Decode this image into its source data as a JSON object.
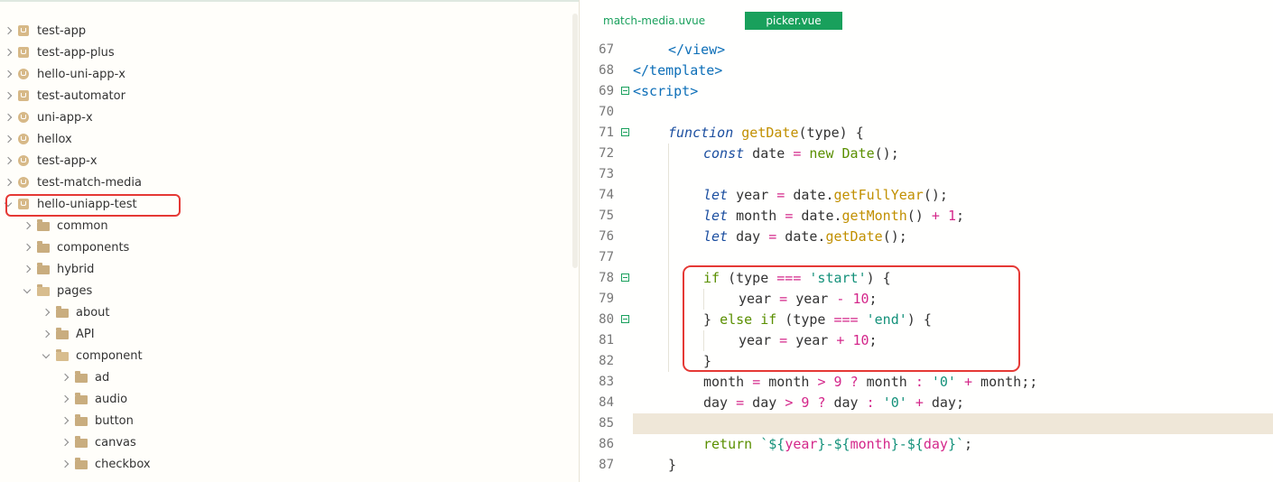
{
  "explorer": {
    "projects": [
      {
        "label": "test-app",
        "icon": "project-square-icon"
      },
      {
        "label": "test-app-plus",
        "icon": "project-square-icon"
      },
      {
        "label": "hello-uni-app-x",
        "icon": "project-round-icon"
      },
      {
        "label": "test-automator",
        "icon": "project-square-icon"
      },
      {
        "label": "uni-app-x",
        "icon": "project-round-icon"
      },
      {
        "label": "hellox",
        "icon": "project-round-icon"
      },
      {
        "label": "test-app-x",
        "icon": "project-round-icon"
      },
      {
        "label": "test-match-media",
        "icon": "project-round-icon"
      },
      {
        "label": "hello-uniapp-test",
        "icon": "project-square-icon",
        "expanded": true,
        "highlighted": true
      }
    ],
    "children": [
      {
        "label": "common",
        "level": 1
      },
      {
        "label": "components",
        "level": 1
      },
      {
        "label": "hybrid",
        "level": 1
      },
      {
        "label": "pages",
        "level": 1,
        "expanded": true
      },
      {
        "label": "about",
        "level": 2
      },
      {
        "label": "API",
        "level": 2
      },
      {
        "label": "component",
        "level": 2,
        "expanded": true
      },
      {
        "label": "ad",
        "level": 3
      },
      {
        "label": "audio",
        "level": 3
      },
      {
        "label": "button",
        "level": 3
      },
      {
        "label": "canvas",
        "level": 3
      },
      {
        "label": "checkbox",
        "level": 3
      }
    ]
  },
  "editor": {
    "tabs": [
      {
        "label": "match-media.uvue",
        "active": false
      },
      {
        "label": "picker.vue",
        "active": true
      }
    ],
    "current_line": 85,
    "highlighted_lines": [
      78,
      82
    ],
    "lines": [
      {
        "n": "67",
        "indent": 1,
        "fold": false,
        "tokens": [
          [
            "tag",
            "</view>"
          ]
        ]
      },
      {
        "n": "68",
        "indent": 0,
        "fold": false,
        "tokens": [
          [
            "tag",
            "</template>"
          ]
        ]
      },
      {
        "n": "69",
        "indent": 0,
        "fold": true,
        "tokens": [
          [
            "tag",
            "<script>"
          ]
        ]
      },
      {
        "n": "70",
        "indent": 0,
        "fold": false,
        "tokens": []
      },
      {
        "n": "71",
        "indent": 1,
        "fold": true,
        "tokens": [
          [
            "kw-italic",
            "function"
          ],
          [
            "",
            " "
          ],
          [
            "fn",
            "getDate"
          ],
          [
            "",
            "(type) {"
          ]
        ]
      },
      {
        "n": "72",
        "indent": 2,
        "fold": false,
        "tokens": [
          [
            "kw-italic",
            "const"
          ],
          [
            "",
            " date "
          ],
          [
            "op",
            "="
          ],
          [
            "",
            " "
          ],
          [
            "kw-green",
            "new"
          ],
          [
            "",
            " "
          ],
          [
            "kw-green",
            "Date"
          ],
          [
            "",
            "();"
          ]
        ]
      },
      {
        "n": "73",
        "indent": 0,
        "fold": false,
        "tokens": []
      },
      {
        "n": "74",
        "indent": 2,
        "fold": false,
        "tokens": [
          [
            "kw-italic",
            "let"
          ],
          [
            "",
            " year "
          ],
          [
            "op",
            "="
          ],
          [
            "",
            " date."
          ],
          [
            "fn",
            "getFullYear"
          ],
          [
            "",
            "();"
          ]
        ]
      },
      {
        "n": "75",
        "indent": 2,
        "fold": false,
        "tokens": [
          [
            "kw-italic",
            "let"
          ],
          [
            "",
            " month "
          ],
          [
            "op",
            "="
          ],
          [
            "",
            " date."
          ],
          [
            "fn",
            "getMonth"
          ],
          [
            "",
            "() "
          ],
          [
            "op",
            "+"
          ],
          [
            "",
            " "
          ],
          [
            "num",
            "1"
          ],
          [
            "",
            ";"
          ]
        ]
      },
      {
        "n": "76",
        "indent": 2,
        "fold": false,
        "tokens": [
          [
            "kw-italic",
            "let"
          ],
          [
            "",
            " day "
          ],
          [
            "op",
            "="
          ],
          [
            "",
            " date."
          ],
          [
            "fn",
            "getDate"
          ],
          [
            "",
            "();"
          ]
        ]
      },
      {
        "n": "77",
        "indent": 0,
        "fold": false,
        "tokens": []
      },
      {
        "n": "78",
        "indent": 2,
        "fold": true,
        "tokens": [
          [
            "kw-green",
            "if"
          ],
          [
            "",
            " (type "
          ],
          [
            "op",
            "==="
          ],
          [
            "",
            " "
          ],
          [
            "str",
            "'start'"
          ],
          [
            "",
            ") {"
          ]
        ]
      },
      {
        "n": "79",
        "indent": 3,
        "fold": false,
        "tokens": [
          [
            "",
            "year "
          ],
          [
            "op",
            "="
          ],
          [
            "",
            " year "
          ],
          [
            "op",
            "-"
          ],
          [
            "",
            " "
          ],
          [
            "num",
            "10"
          ],
          [
            "",
            ";"
          ]
        ]
      },
      {
        "n": "80",
        "indent": 2,
        "fold": true,
        "tokens": [
          [
            "",
            "} "
          ],
          [
            "kw-green",
            "else"
          ],
          [
            "",
            " "
          ],
          [
            "kw-green",
            "if"
          ],
          [
            "",
            " (type "
          ],
          [
            "op",
            "==="
          ],
          [
            "",
            " "
          ],
          [
            "str",
            "'end'"
          ],
          [
            "",
            ") {"
          ]
        ]
      },
      {
        "n": "81",
        "indent": 3,
        "fold": false,
        "tokens": [
          [
            "",
            "year "
          ],
          [
            "op",
            "="
          ],
          [
            "",
            " year "
          ],
          [
            "op",
            "+"
          ],
          [
            "",
            " "
          ],
          [
            "num",
            "10"
          ],
          [
            "",
            ";"
          ]
        ]
      },
      {
        "n": "82",
        "indent": 2,
        "fold": false,
        "tokens": [
          [
            "",
            "}"
          ]
        ]
      },
      {
        "n": "83",
        "indent": 2,
        "fold": false,
        "tokens": [
          [
            "",
            "month "
          ],
          [
            "op",
            "="
          ],
          [
            "",
            " month "
          ],
          [
            "op",
            ">"
          ],
          [
            "",
            " "
          ],
          [
            "num",
            "9"
          ],
          [
            "",
            " "
          ],
          [
            "op",
            "?"
          ],
          [
            "",
            " month "
          ],
          [
            "op",
            ":"
          ],
          [
            "",
            " "
          ],
          [
            "str",
            "'0'"
          ],
          [
            "",
            " "
          ],
          [
            "op",
            "+"
          ],
          [
            "",
            " month;;"
          ]
        ]
      },
      {
        "n": "84",
        "indent": 2,
        "fold": false,
        "tokens": [
          [
            "",
            "day "
          ],
          [
            "op",
            "="
          ],
          [
            "",
            " day "
          ],
          [
            "op",
            ">"
          ],
          [
            "",
            " "
          ],
          [
            "num",
            "9"
          ],
          [
            "",
            " "
          ],
          [
            "op",
            "?"
          ],
          [
            "",
            " day "
          ],
          [
            "op",
            ":"
          ],
          [
            "",
            " "
          ],
          [
            "str",
            "'0'"
          ],
          [
            "",
            " "
          ],
          [
            "op",
            "+"
          ],
          [
            "",
            " day;"
          ]
        ]
      },
      {
        "n": "85",
        "indent": 0,
        "fold": false,
        "tokens": []
      },
      {
        "n": "86",
        "indent": 2,
        "fold": false,
        "tokens": [
          [
            "kw-green",
            "return"
          ],
          [
            "",
            " "
          ],
          [
            "str",
            "`${"
          ],
          [
            "op",
            "year"
          ],
          [
            "str",
            "}-${"
          ],
          [
            "op",
            "month"
          ],
          [
            "str",
            "}-${"
          ],
          [
            "op",
            "day"
          ],
          [
            "str",
            "}`"
          ],
          [
            "",
            ";"
          ]
        ]
      },
      {
        "n": "87",
        "indent": 1,
        "fold": false,
        "tokens": [
          [
            "",
            "}"
          ]
        ]
      }
    ]
  }
}
